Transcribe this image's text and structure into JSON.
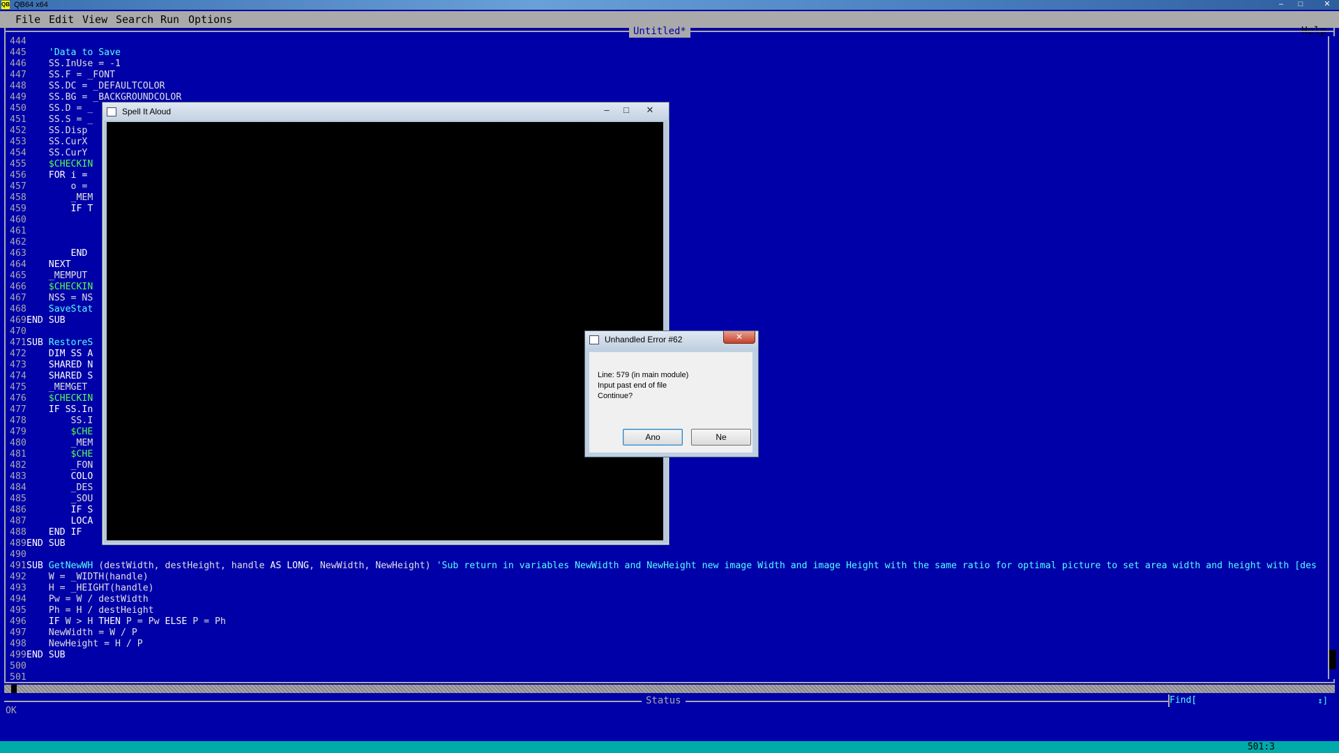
{
  "window": {
    "title": "QB64 x64",
    "app_icon": "QB"
  },
  "menu": {
    "items": [
      "File",
      "Edit",
      "View",
      "Search",
      "Run",
      "Options"
    ],
    "help": "Help"
  },
  "editor": {
    "file_title": "Untitled*",
    "lines": [
      {
        "n": "444",
        "parts": []
      },
      {
        "n": "445",
        "parts": [
          {
            "c": "cm",
            "t": "    'Data to Save"
          }
        ]
      },
      {
        "n": "446",
        "parts": [
          {
            "c": "txt",
            "t": "    SS.InUse = -1"
          }
        ]
      },
      {
        "n": "447",
        "parts": [
          {
            "c": "txt",
            "t": "    SS.F = _FONT"
          }
        ]
      },
      {
        "n": "448",
        "parts": [
          {
            "c": "txt",
            "t": "    SS.DC = _DEFAULTCOLOR"
          }
        ]
      },
      {
        "n": "449",
        "parts": [
          {
            "c": "txt",
            "t": "    SS.BG = _BACKGROUNDCOLOR"
          }
        ]
      },
      {
        "n": "450",
        "parts": [
          {
            "c": "txt",
            "t": "    SS.D = _"
          }
        ]
      },
      {
        "n": "451",
        "parts": [
          {
            "c": "txt",
            "t": "    SS.S = _"
          }
        ]
      },
      {
        "n": "452",
        "parts": [
          {
            "c": "txt",
            "t": "    SS.Disp"
          }
        ]
      },
      {
        "n": "453",
        "parts": [
          {
            "c": "txt",
            "t": "    SS.CurX"
          }
        ]
      },
      {
        "n": "454",
        "parts": [
          {
            "c": "txt",
            "t": "    SS.CurY"
          }
        ]
      },
      {
        "n": "455",
        "parts": [
          {
            "c": "meta",
            "t": "    $CHECKIN"
          }
        ]
      },
      {
        "n": "456",
        "parts": [
          {
            "c": "kw",
            "t": "    FOR i ="
          }
        ]
      },
      {
        "n": "457",
        "parts": [
          {
            "c": "txt",
            "t": "        o ="
          }
        ]
      },
      {
        "n": "458",
        "parts": [
          {
            "c": "txt",
            "t": "        _MEM"
          }
        ]
      },
      {
        "n": "459",
        "parts": [
          {
            "c": "kw",
            "t": "        IF T"
          }
        ]
      },
      {
        "n": "460",
        "parts": []
      },
      {
        "n": "461",
        "parts": []
      },
      {
        "n": "462",
        "parts": []
      },
      {
        "n": "463",
        "parts": [
          {
            "c": "kw",
            "t": "        END"
          }
        ]
      },
      {
        "n": "464",
        "parts": [
          {
            "c": "kw",
            "t": "    NEXT"
          }
        ]
      },
      {
        "n": "465",
        "parts": [
          {
            "c": "txt",
            "t": "    _MEMPUT"
          }
        ]
      },
      {
        "n": "466",
        "parts": [
          {
            "c": "meta",
            "t": "    $CHECKIN"
          }
        ]
      },
      {
        "n": "467",
        "parts": [
          {
            "c": "txt",
            "t": "    NSS = NS"
          }
        ]
      },
      {
        "n": "468",
        "parts": [
          {
            "c": "sub",
            "t": "    SaveStat"
          }
        ]
      },
      {
        "n": "469",
        "parts": [
          {
            "c": "kw",
            "t": "END SUB"
          }
        ]
      },
      {
        "n": "470",
        "parts": []
      },
      {
        "n": "471",
        "parts": [
          {
            "c": "kw",
            "t": "SUB "
          },
          {
            "c": "sub",
            "t": "RestoreS"
          }
        ]
      },
      {
        "n": "472",
        "parts": [
          {
            "c": "kw",
            "t": "    DIM SS A"
          }
        ]
      },
      {
        "n": "473",
        "parts": [
          {
            "c": "kw",
            "t": "    SHARED N"
          }
        ]
      },
      {
        "n": "474",
        "parts": [
          {
            "c": "kw",
            "t": "    SHARED S"
          }
        ]
      },
      {
        "n": "475",
        "parts": [
          {
            "c": "txt",
            "t": "    _MEMGET"
          }
        ]
      },
      {
        "n": "476",
        "parts": [
          {
            "c": "meta",
            "t": "    $CHECKIN"
          }
        ]
      },
      {
        "n": "477",
        "parts": [
          {
            "c": "kw",
            "t": "    IF SS.In"
          }
        ]
      },
      {
        "n": "478",
        "parts": [
          {
            "c": "txt",
            "t": "        SS.I"
          }
        ]
      },
      {
        "n": "479",
        "parts": [
          {
            "c": "meta",
            "t": "        $CHE"
          }
        ]
      },
      {
        "n": "480",
        "parts": [
          {
            "c": "txt",
            "t": "        _MEM"
          }
        ]
      },
      {
        "n": "481",
        "parts": [
          {
            "c": "meta",
            "t": "        $CHE"
          }
        ]
      },
      {
        "n": "482",
        "parts": [
          {
            "c": "txt",
            "t": "        _FON"
          }
        ]
      },
      {
        "n": "483",
        "parts": [
          {
            "c": "kw",
            "t": "        COLO"
          }
        ]
      },
      {
        "n": "484",
        "parts": [
          {
            "c": "txt",
            "t": "        _DES"
          }
        ]
      },
      {
        "n": "485",
        "parts": [
          {
            "c": "txt",
            "t": "        _SOU"
          }
        ]
      },
      {
        "n": "486",
        "parts": [
          {
            "c": "kw",
            "t": "        IF S"
          }
        ]
      },
      {
        "n": "487",
        "parts": [
          {
            "c": "kw",
            "t": "        LOCA"
          }
        ]
      },
      {
        "n": "488",
        "parts": [
          {
            "c": "kw",
            "t": "    END IF"
          }
        ]
      },
      {
        "n": "489",
        "parts": [
          {
            "c": "kw",
            "t": "END SUB"
          }
        ]
      },
      {
        "n": "490",
        "parts": []
      },
      {
        "n": "491",
        "parts": [
          {
            "c": "kw",
            "t": "SUB "
          },
          {
            "c": "sub",
            "t": "GetNewWH"
          },
          {
            "c": "txt",
            "t": " (destWidth, destHeight, handle "
          },
          {
            "c": "kw",
            "t": "AS LONG"
          },
          {
            "c": "txt",
            "t": ", NewWidth, NewHeight) "
          },
          {
            "c": "cm",
            "t": "'Sub return in variables NewWidth and NewHeight new image Width and image Height with the same ratio for optimal picture to set area width and height with [des"
          }
        ]
      },
      {
        "n": "492",
        "parts": [
          {
            "c": "txt",
            "t": "    W = _WIDTH(handle)"
          }
        ]
      },
      {
        "n": "493",
        "parts": [
          {
            "c": "txt",
            "t": "    H = _HEIGHT(handle)"
          }
        ]
      },
      {
        "n": "494",
        "parts": [
          {
            "c": "txt",
            "t": "    Pw = W / destWidth"
          }
        ]
      },
      {
        "n": "495",
        "parts": [
          {
            "c": "txt",
            "t": "    Ph = H / destHeight"
          }
        ]
      },
      {
        "n": "496",
        "parts": [
          {
            "c": "kw",
            "t": "    IF"
          },
          {
            "c": "txt",
            "t": " W > H "
          },
          {
            "c": "kw",
            "t": "THEN"
          },
          {
            "c": "txt",
            "t": " P = Pw "
          },
          {
            "c": "kw",
            "t": "ELSE"
          },
          {
            "c": "txt",
            "t": " P = Ph"
          }
        ]
      },
      {
        "n": "497",
        "parts": [
          {
            "c": "txt",
            "t": "    NewWidth = W / P"
          }
        ]
      },
      {
        "n": "498",
        "parts": [
          {
            "c": "txt",
            "t": "    NewHeight = H / P"
          }
        ]
      },
      {
        "n": "499",
        "parts": [
          {
            "c": "kw",
            "t": "END SUB"
          }
        ]
      },
      {
        "n": "500",
        "parts": []
      },
      {
        "n": "501",
        "parts": []
      }
    ]
  },
  "status": {
    "title": "Status",
    "text": "OK",
    "find_label": "Find[",
    "find_arrows": "↕]",
    "cursor_pos": "501:3"
  },
  "spell_window": {
    "title": "Spell It Aloud",
    "minimize": "‒",
    "maximize": "□",
    "close": "✕"
  },
  "error_dialog": {
    "title": "Unhandled Error #62",
    "close": "✕",
    "message": [
      "Line: 579 (in main module)",
      "Input past end of file",
      "Continue?"
    ],
    "yes_label": "Ano",
    "no_label": "Ne"
  },
  "colors": {
    "editor_bg": "#0000a8",
    "keyword": "#ffffff",
    "sub_name": "#55ffff",
    "metacommand": "#55ff55",
    "menu_bg": "#aaaaaa"
  }
}
